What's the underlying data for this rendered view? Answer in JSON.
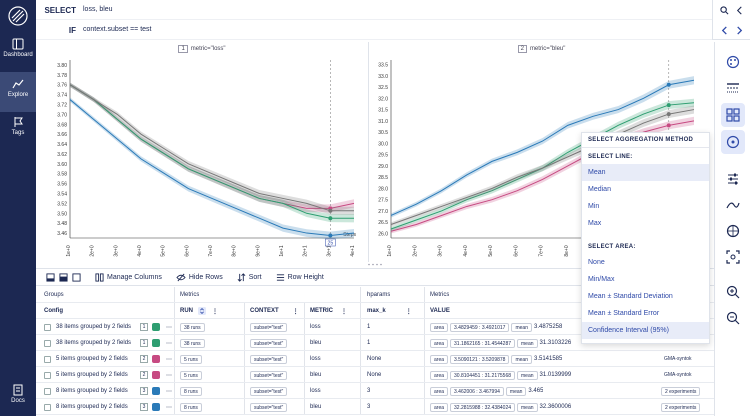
{
  "sidebar": {
    "items": [
      {
        "label": "Dashboard",
        "icon": "dashboard-icon"
      },
      {
        "label": "Explore",
        "icon": "explore-icon",
        "active": true
      },
      {
        "label": "Tags",
        "icon": "tag-icon"
      },
      {
        "label": "Docs",
        "icon": "docs-icon"
      }
    ]
  },
  "query": {
    "select_label": "SELECT",
    "select_value": "loss, bleu",
    "if_label": "IF",
    "if_value": "context.subset == test"
  },
  "panels": [
    {
      "index": "1",
      "title": "metric=\"loss\""
    },
    {
      "index": "2",
      "title": "metric=\"bleu\""
    }
  ],
  "chart_data": [
    {
      "type": "line",
      "title": "metric=\"loss\"",
      "xlabel": "Steps",
      "x_ticks": [
        "1e+0",
        "2e+0",
        "3e+0",
        "4e+0",
        "5e+0",
        "6e+0",
        "7e+0",
        "8e+0",
        "9e+0",
        "1e+1",
        "2e+1",
        "3e+1",
        "4e+1"
      ],
      "y_ticks": [
        3.8,
        3.78,
        3.76,
        3.74,
        3.72,
        3.7,
        3.68,
        3.66,
        3.64,
        3.62,
        3.6,
        3.58,
        3.56,
        3.54,
        3.52,
        3.5,
        3.48,
        3.46
      ],
      "ylim": [
        3.45,
        3.81
      ],
      "cursor_label": "25",
      "series": [
        {
          "color": "#2a7ab8",
          "values": [
            3.73,
            3.69,
            3.65,
            3.61,
            3.58,
            3.55,
            3.53,
            3.51,
            3.49,
            3.47,
            3.46,
            3.455,
            3.46
          ]
        },
        {
          "color": "#c74a82",
          "values": [
            3.76,
            3.73,
            3.69,
            3.65,
            3.62,
            3.59,
            3.57,
            3.55,
            3.53,
            3.52,
            3.51,
            3.51,
            3.52
          ]
        },
        {
          "color": "#2e9e71",
          "values": [
            3.76,
            3.73,
            3.69,
            3.65,
            3.62,
            3.59,
            3.57,
            3.55,
            3.53,
            3.52,
            3.5,
            3.49,
            3.49
          ]
        },
        {
          "color": "#777777",
          "values": [
            3.76,
            3.73,
            3.7,
            3.66,
            3.63,
            3.6,
            3.58,
            3.56,
            3.54,
            3.53,
            3.52,
            3.505,
            3.505
          ]
        }
      ]
    },
    {
      "type": "line",
      "title": "metric=\"bleu\"",
      "xlabel": "Steps",
      "x_ticks": [
        "1e+0",
        "2e+0",
        "3e+0",
        "4e+0",
        "5e+0",
        "6e+0",
        "7e+0",
        "8e+0",
        "9e+0",
        "1e+1",
        "2e+1",
        "3e+1",
        "4e+1"
      ],
      "y_ticks": [
        33.5,
        33.0,
        32.5,
        32.0,
        31.5,
        31.0,
        30.5,
        30.0,
        29.5,
        29.0,
        28.5,
        28.0,
        27.5,
        27.0,
        26.5,
        26.0
      ],
      "ylim": [
        25.8,
        33.7
      ],
      "series": [
        {
          "color": "#2a7ab8",
          "values": [
            26.8,
            27.3,
            27.9,
            28.6,
            29.2,
            29.6,
            30.1,
            30.8,
            31.2,
            31.5,
            32.0,
            32.6,
            32.8
          ]
        },
        {
          "color": "#c74a82",
          "values": [
            26.1,
            26.4,
            26.8,
            27.2,
            27.5,
            27.9,
            28.4,
            29.0,
            29.6,
            30.1,
            30.5,
            30.8,
            31.0
          ]
        },
        {
          "color": "#2e9e71",
          "values": [
            26.2,
            26.6,
            27.0,
            27.5,
            27.9,
            28.4,
            28.9,
            29.6,
            30.2,
            30.8,
            31.3,
            31.7,
            31.8
          ]
        },
        {
          "color": "#777777",
          "values": [
            26.4,
            26.8,
            27.2,
            27.6,
            28.0,
            28.5,
            28.9,
            29.4,
            29.9,
            30.4,
            30.9,
            31.3,
            31.5
          ]
        }
      ]
    }
  ],
  "popover": {
    "title": "SELECT AGGREGATION METHOD",
    "line_heading": "SELECT LINE:",
    "line_options": [
      "Mean",
      "Median",
      "Min",
      "Max"
    ],
    "line_selected": 0,
    "area_heading": "SELECT AREA:",
    "area_options": [
      "None",
      "Min/Max",
      "Mean ± Standard Deviation",
      "Mean ± Standard Error",
      "Confidence Interval (95%)"
    ],
    "area_selected": 4
  },
  "toolbar": {
    "manage_columns": "Manage Columns",
    "hide_rows": "Hide Rows",
    "sort": "Sort",
    "row_height": "Row Height"
  },
  "table": {
    "groups_header": "Groups",
    "metrics_header": "Metrics",
    "hparams_header": "hparams",
    "metrics2_header": "Metrics",
    "config_label": "Config",
    "run_label": "RUN",
    "context_label": "CONTEXT",
    "metric_label": "METRIC",
    "maxk_label": "max_k",
    "value_label": "VALUE",
    "rows": [
      {
        "group": "38 items grouped by 2 fields",
        "badge": "1",
        "color": "#2e9e71",
        "runs": "38 runs",
        "context": "subset=\"test\"",
        "metric": "loss",
        "maxk": "1",
        "area": "area",
        "range": "3.4829459 : 3.4921017",
        "mean": "mean",
        "mean_val": "3.4875258",
        "extra": ""
      },
      {
        "group": "38 items grouped by 2 fields",
        "badge": "1",
        "color": "#2e9e71",
        "runs": "38 runs",
        "context": "subset=\"test\"",
        "metric": "bleu",
        "maxk": "1",
        "area": "area",
        "range": "31.1862165 : 31.4544287",
        "mean": "mean",
        "mean_val": "31.3103226",
        "extra": ""
      },
      {
        "group": "5 items grouped by 2 fields",
        "badge": "2",
        "color": "#c74a82",
        "runs": "5 runs",
        "context": "subset=\"test\"",
        "metric": "loss",
        "maxk": "None",
        "area": "area",
        "range": "3.5090121 : 3.5209878",
        "mean": "mean",
        "mean_val": "3.5141585",
        "extra": "GMA-syntok"
      },
      {
        "group": "5 items grouped by 2 fields",
        "badge": "2",
        "color": "#c74a82",
        "runs": "5 runs",
        "context": "subset=\"test\"",
        "metric": "bleu",
        "maxk": "None",
        "area": "area",
        "range": "30.8104451 : 31.2175568",
        "mean": "mean",
        "mean_val": "31.0139999",
        "extra": "GMA-syntok"
      },
      {
        "group": "8 items grouped by 2 fields",
        "badge": "3",
        "color": "#2a7ab8",
        "runs": "8 runs",
        "context": "subset=\"test\"",
        "metric": "loss",
        "maxk": "3",
        "area": "area",
        "range": "3.462006 : 3.467994",
        "mean": "mean",
        "mean_val": "3.465",
        "extra": "2 experiments"
      },
      {
        "group": "8 items grouped by 2 fields",
        "badge": "3",
        "color": "#2a7ab8",
        "runs": "8 runs",
        "context": "subset=\"test\"",
        "metric": "bleu",
        "maxk": "3",
        "area": "area",
        "range": "32.2815988 : 32.4384024",
        "mean": "mean",
        "mean_val": "32.3600006",
        "extra": "2 experiments"
      }
    ]
  }
}
